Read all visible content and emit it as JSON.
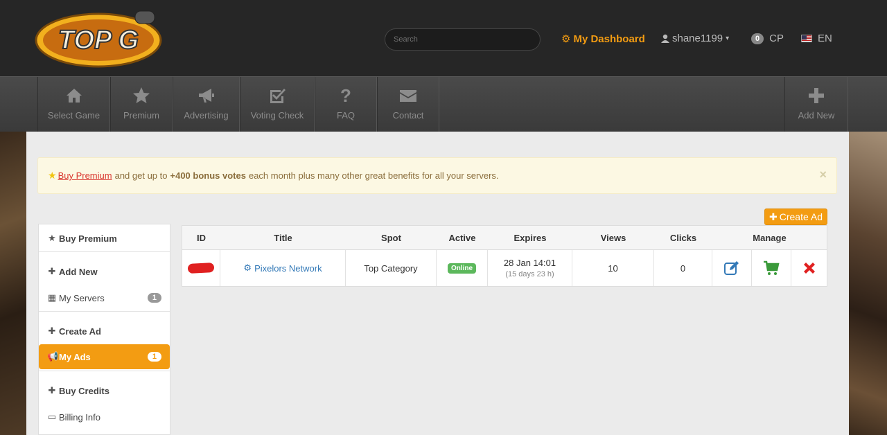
{
  "header": {
    "logo_text": "TOP G",
    "search_placeholder": "Search",
    "dashboard_label": "My Dashboard",
    "username": "shane1199",
    "cp_count": "0",
    "cp_label": "CP",
    "language": "EN"
  },
  "nav": {
    "items": [
      {
        "label": "Select Game",
        "icon": "home-icon"
      },
      {
        "label": "Premium",
        "icon": "star-icon"
      },
      {
        "label": "Advertising",
        "icon": "megaphone-icon"
      },
      {
        "label": "Voting Check",
        "icon": "checkbox-icon"
      },
      {
        "label": "FAQ",
        "icon": "question-icon"
      },
      {
        "label": "Contact",
        "icon": "envelope-icon"
      }
    ],
    "add_new": "Add New"
  },
  "alert": {
    "link_text": "Buy Premium",
    "text_before": "and get up to",
    "bold_text": "+400 bonus votes",
    "text_after": "each month plus many other great benefits for all your servers.",
    "close": "×"
  },
  "sidebar": {
    "items": [
      {
        "label": "Buy Premium",
        "icon": "star-icon"
      },
      {
        "label": "Add New",
        "icon": "plus-icon"
      },
      {
        "label": "My Servers",
        "icon": "grid-icon",
        "count": "1"
      },
      {
        "label": "Create Ad",
        "icon": "plus-icon"
      },
      {
        "label": "My Ads",
        "icon": "megaphone-icon",
        "count": "1"
      },
      {
        "label": "Buy Credits",
        "icon": "plus-icon"
      },
      {
        "label": "Billing Info",
        "icon": "credit-card-icon"
      }
    ]
  },
  "create_ad_label": "Create Ad",
  "table": {
    "headers": [
      "ID",
      "Title",
      "Spot",
      "Active",
      "Expires",
      "Views",
      "Clicks",
      "Manage"
    ],
    "row": {
      "title": "Pixelors Network",
      "spot": "Top Category",
      "active": "Online",
      "expires": "28 Jan 14:01",
      "expires_sub": "(15 days 23 h)",
      "views": "10",
      "clicks": "0"
    }
  },
  "colors": {
    "accent": "#f39c12",
    "link": "#3379b7",
    "online": "#5cb85c",
    "delete": "#e02020"
  }
}
